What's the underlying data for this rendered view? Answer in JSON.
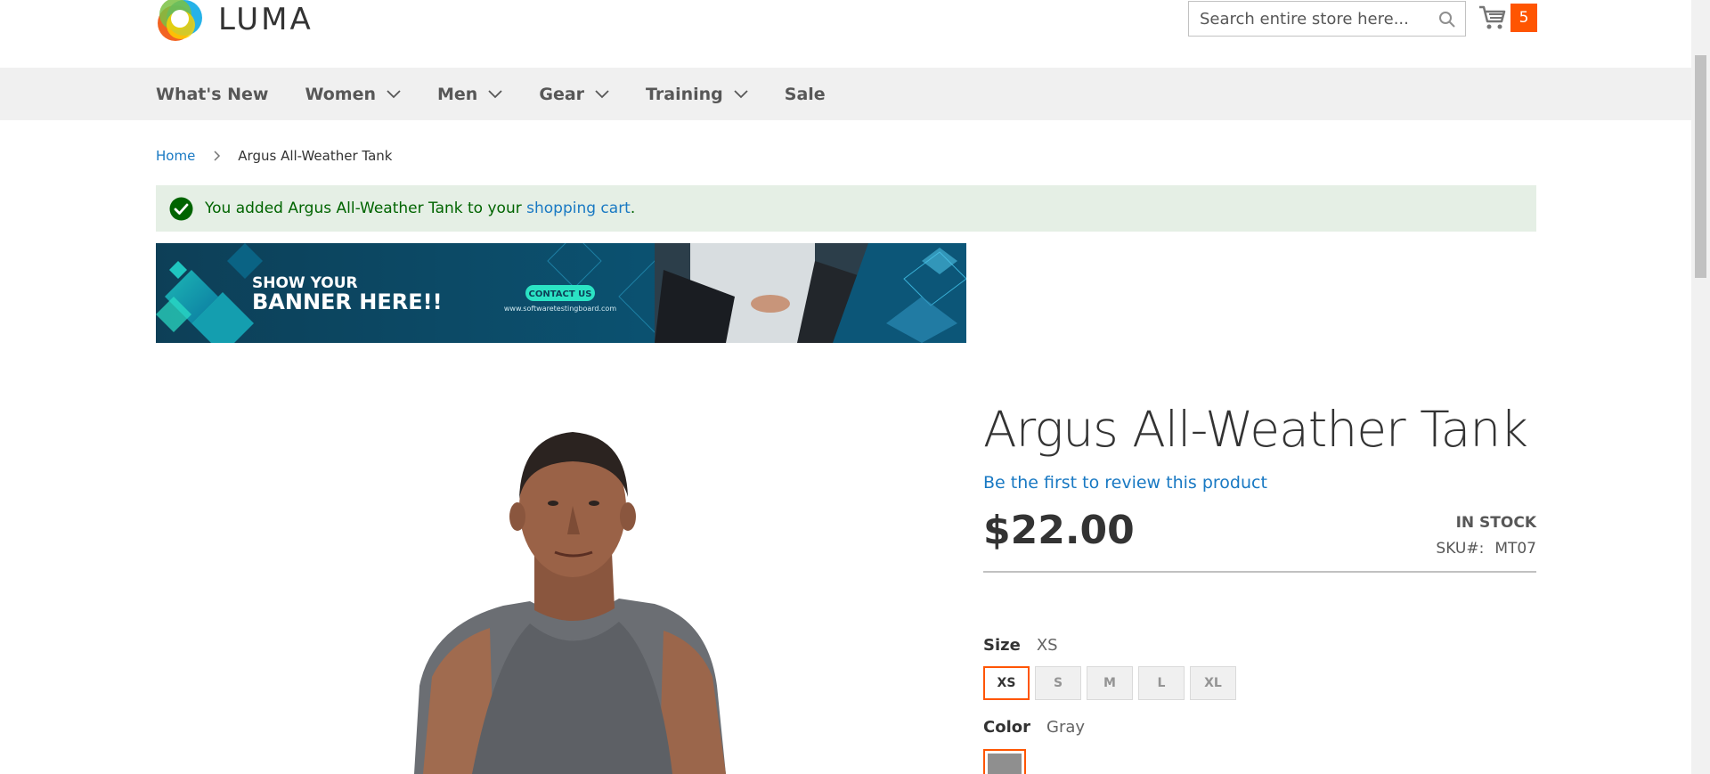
{
  "header": {
    "logo_text": "LUMA",
    "search_placeholder": "Search entire store here...",
    "cart_count": "5"
  },
  "nav": {
    "items": [
      {
        "label": "What's New",
        "has_dropdown": false
      },
      {
        "label": "Women",
        "has_dropdown": true
      },
      {
        "label": "Men",
        "has_dropdown": true
      },
      {
        "label": "Gear",
        "has_dropdown": true
      },
      {
        "label": "Training",
        "has_dropdown": true
      },
      {
        "label": "Sale",
        "has_dropdown": false
      }
    ]
  },
  "breadcrumb": {
    "home": "Home",
    "current": "Argus All-Weather Tank"
  },
  "message": {
    "prefix": "You added Argus All-Weather Tank to your ",
    "link": "shopping cart",
    "suffix": "."
  },
  "banner": {
    "line1": "SHOW YOUR",
    "line2": "BANNER HERE!!",
    "cta": "CONTACT US",
    "url": "www.softwaretestingboard.com"
  },
  "product": {
    "title": "Argus All-Weather Tank",
    "review_link": "Be the first to review this product",
    "price": "$22.00",
    "stock": "In stock",
    "sku_label": "SKU#:",
    "sku": "MT07",
    "size_label": "Size",
    "size_selected": "XS",
    "sizes": [
      "XS",
      "S",
      "M",
      "L",
      "XL"
    ],
    "color_label": "Color",
    "color_selected": "Gray"
  },
  "colors": {
    "accent": "#ff5501",
    "link": "#1979c3",
    "success_bg": "#e5efe5",
    "success_text": "#006400"
  }
}
